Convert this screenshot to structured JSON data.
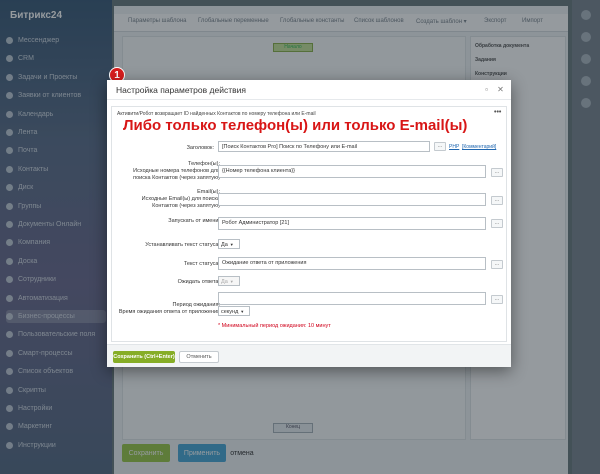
{
  "app": {
    "logo": "Битрикс24",
    "sidebar": [
      {
        "label": "Мессенджер"
      },
      {
        "label": "CRM"
      },
      {
        "label": "Задачи и Проекты"
      },
      {
        "label": "Заявки от клиентов"
      },
      {
        "label": "Календарь"
      },
      {
        "label": "Лента"
      },
      {
        "label": "Почта"
      },
      {
        "label": "Контакты"
      },
      {
        "label": "Диск"
      },
      {
        "label": "Группы"
      },
      {
        "label": "Документы Онлайн"
      },
      {
        "label": "Компания"
      },
      {
        "label": "Доска"
      },
      {
        "label": "Сотрудники"
      },
      {
        "label": "Автоматизация"
      },
      {
        "label": "Бизнес-процессы"
      },
      {
        "label": "Пользовательские поля"
      },
      {
        "label": "Смарт-процессы"
      },
      {
        "label": "Список объектов"
      },
      {
        "label": "Скрипты"
      },
      {
        "label": "Настройки"
      },
      {
        "label": "Маркетинг"
      },
      {
        "label": "Инструкции"
      }
    ],
    "tabs": [
      "Параметры шаблона",
      "Глобальные переменные",
      "Глобальные константы",
      "Список шаблонов",
      "Создать шаблон ▾",
      "Экспорт",
      "Импорт"
    ],
    "designer": {
      "start": "Начало",
      "end": "Конец"
    },
    "right_panel": [
      "Обработка документа",
      "Задания",
      "Конструкции"
    ],
    "bottom_buttons": {
      "save": "Сохранить",
      "apply": "Применить",
      "cancel": "отмена"
    }
  },
  "dialog": {
    "title": "Настройка параметров действия",
    "step_badge": "1",
    "description": "Активити/Робот возвращает ID найденных Контактов по номеру телефона или E-mail",
    "annotation": "Либо только телефон(ы) или только E-mail(ы)",
    "fields": {
      "title_label": "Заголовок:",
      "title_value": "[Поиск Контактов Pro] Поиск по Телефону или E-mail",
      "title_link_php": "PHP",
      "title_link_comment": "[Комментарий]",
      "phones_label": "Телефон(ы):",
      "phones_sublabel": "Исходные номера телефонов для поиска Контактов (через запятую)",
      "phones_value": "{{Номер телефона клиента}}",
      "emails_label": "Email(ы):",
      "emails_sublabel": "Исходные Email(ы) для поиска Контактов (через запятую)",
      "emails_value": "",
      "run_as_label": "Запускать от имени:",
      "run_as_value": "Робот Администратор [21]",
      "set_status_label": "Устанавливать текст статуса:",
      "set_status_value": "Да",
      "status_text_label": "Текст статуса:",
      "status_text_value": "Ожидание ответа от приложения",
      "wait_label": "Ожидать ответа:",
      "wait_value": "Да",
      "period_label": "Период ожидания:",
      "period_sublabel": "Время ожидания ответа от приложения",
      "period_value": "",
      "period_unit": "секунд",
      "min_hint": "* Минимальный период ожидания: 10 минут"
    },
    "buttons": {
      "more": "•••",
      "dots": "...",
      "save": "Сохранить (Ctrl+Enter)",
      "cancel": "Отменить"
    }
  }
}
